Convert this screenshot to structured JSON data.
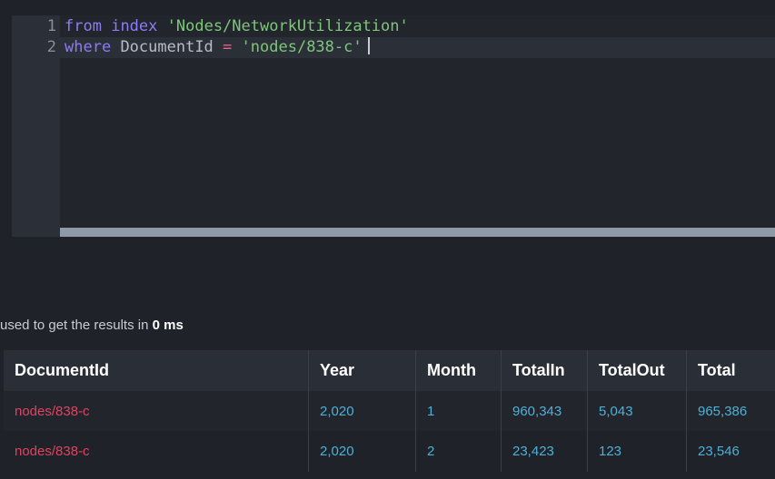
{
  "editor": {
    "lines": [
      {
        "number": "1",
        "kw1": "from",
        "kw2": "index",
        "str": "'Nodes/NetworkUtilization'"
      },
      {
        "number": "2",
        "kw1": "where",
        "field": "DocumentId",
        "op": "=",
        "str": "'nodes/838-c'"
      }
    ]
  },
  "status": {
    "prefix": "used to get the results in",
    "duration": "0 ms"
  },
  "results": {
    "columns": [
      "DocumentId",
      "Year",
      "Month",
      "TotalIn",
      "TotalOut",
      "Total"
    ],
    "rows": [
      [
        "nodes/838-c",
        "2,020",
        "1",
        "960,343",
        "5,043",
        "965,386"
      ],
      [
        "nodes/838-c",
        "2,020",
        "2",
        "23,423",
        "123",
        "23,546"
      ]
    ]
  },
  "colors": {
    "keyword": "#8b7cf6",
    "string": "#7ec67a",
    "operator": "#e0658a",
    "document_id": "#e0435f",
    "number": "#4fb0d6"
  }
}
